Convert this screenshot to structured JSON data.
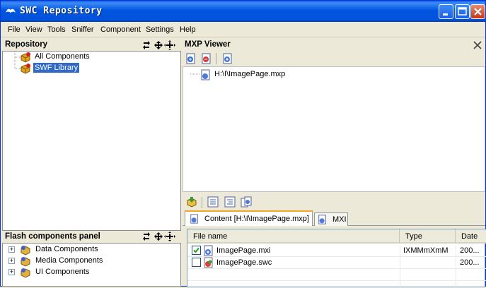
{
  "window": {
    "title": "SWC Repository"
  },
  "menu": {
    "items": [
      "File",
      "View",
      "Tools",
      "Sniffer",
      "Component",
      "Settings",
      "Help"
    ]
  },
  "repository": {
    "header": "Repository",
    "items": [
      {
        "label": "All Components",
        "selected": false
      },
      {
        "label": "SWF Library",
        "selected": true
      }
    ]
  },
  "flash_panel": {
    "header": "Flash components panel",
    "items": [
      {
        "label": "Data Components"
      },
      {
        "label": "Media Components"
      },
      {
        "label": "UI Components"
      }
    ]
  },
  "mxp_viewer": {
    "header": "MXP Viewer",
    "file": "H:\\I\\ImagePage.mxp"
  },
  "tabs": [
    {
      "label": "Content [H:\\I\\ImagePage.mxp]",
      "active": true
    },
    {
      "label": "MXI",
      "active": false
    }
  ],
  "table": {
    "columns": [
      "File name",
      "Type",
      "Date"
    ],
    "rows": [
      {
        "checked": true,
        "name": "ImagePage.mxi",
        "type": "IXMMmXmM",
        "date": "200..."
      },
      {
        "checked": false,
        "name": "ImagePage.swc",
        "type": "",
        "date": "200..."
      }
    ]
  },
  "colors": {
    "titlebar": "#0054e3",
    "selection": "#316ac5",
    "active_tab_accent": "#f5a623"
  }
}
